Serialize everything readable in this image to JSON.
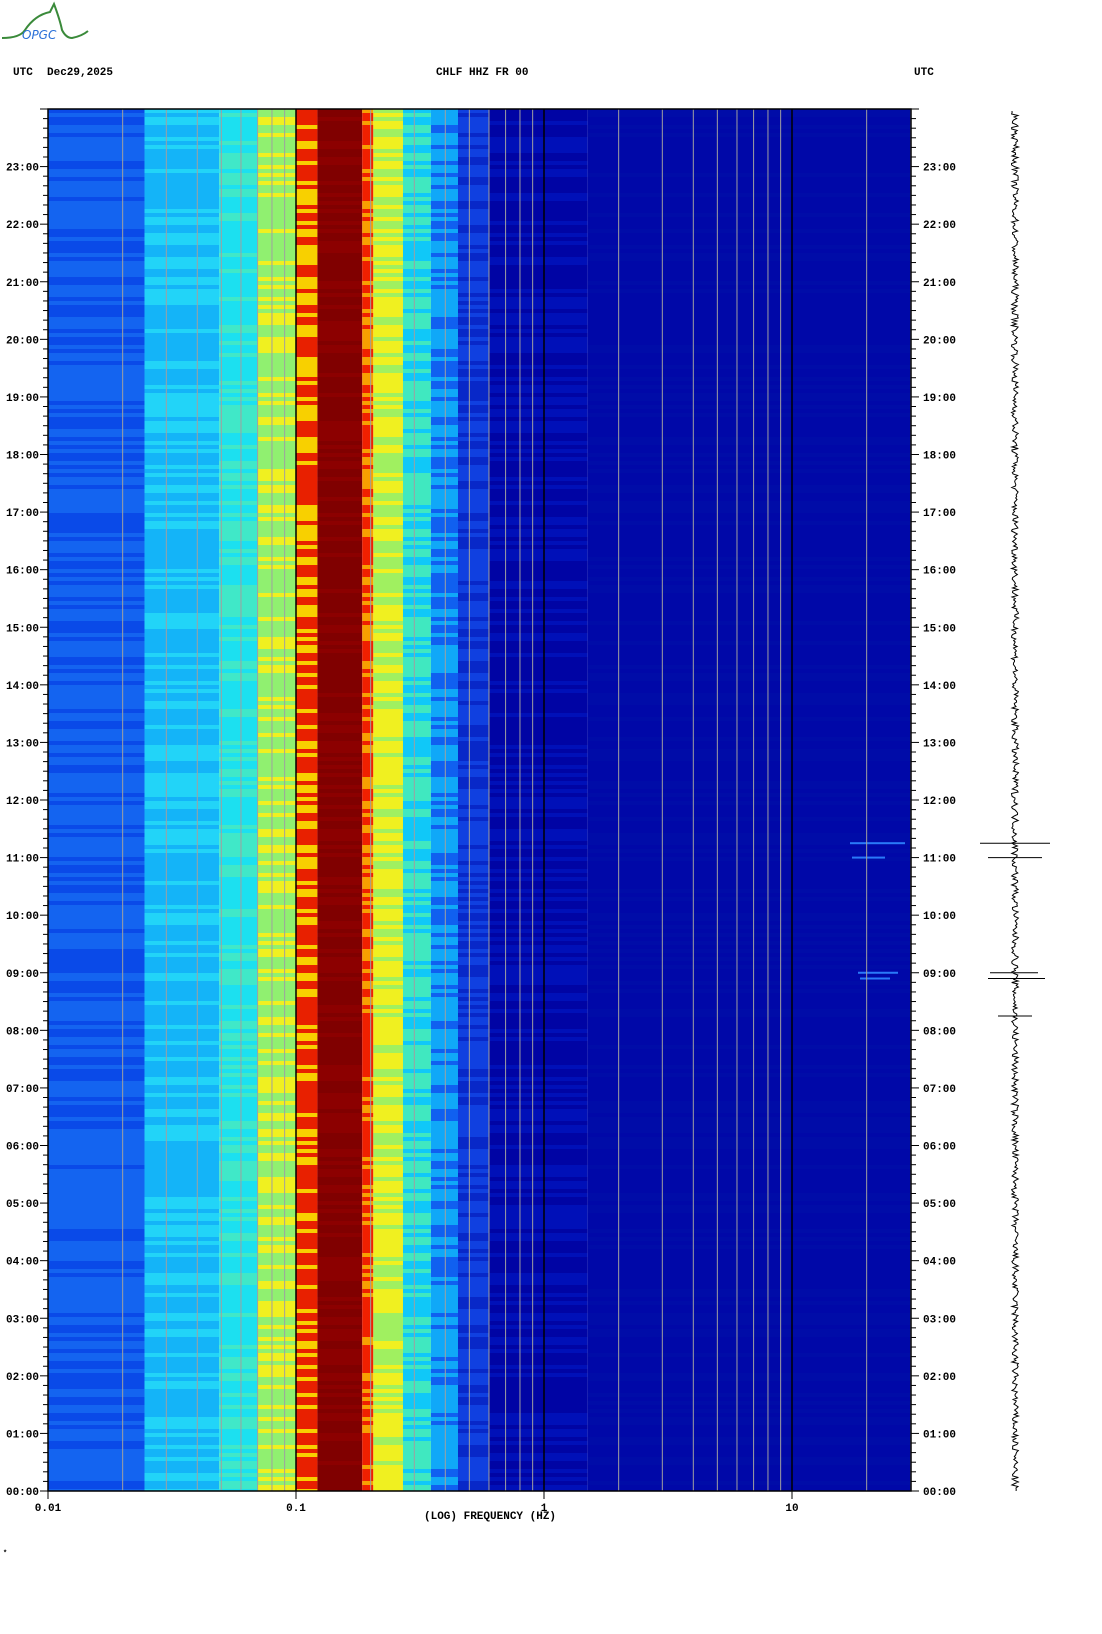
{
  "header": {
    "left_tz": "UTC",
    "date": "Dec29,2025",
    "station": "CHLF HHZ FR 00",
    "right_tz": "UTC"
  },
  "logo_text": "OPGC",
  "footer_mark": "*",
  "chart_data": {
    "type": "heatmap",
    "title": "CHLF HHZ FR 00",
    "subtitle": "Dec29,2025",
    "xlabel": "(LOG) FREQUENCY (HZ)",
    "ylabel": "UTC",
    "xscale": "log",
    "xlim": [
      0.01,
      30
    ],
    "ylim_hours": [
      0,
      24
    ],
    "xticks": [
      {
        "v": 0.01,
        "label": "0.01"
      },
      {
        "v": 0.1,
        "label": "0.1"
      },
      {
        "v": 1,
        "label": "1"
      },
      {
        "v": 10,
        "label": "10"
      }
    ],
    "yticks": [
      "00:00",
      "01:00",
      "02:00",
      "03:00",
      "04:00",
      "05:00",
      "06:00",
      "07:00",
      "08:00",
      "09:00",
      "10:00",
      "11:00",
      "12:00",
      "13:00",
      "14:00",
      "15:00",
      "16:00",
      "17:00",
      "18:00",
      "19:00",
      "20:00",
      "21:00",
      "22:00",
      "23:00"
    ],
    "grid_minor_freqs": [
      0.02,
      0.03,
      0.04,
      0.05,
      0.06,
      0.07,
      0.08,
      0.09,
      0.2,
      0.3,
      0.4,
      0.5,
      0.6,
      0.7,
      0.8,
      0.9,
      2,
      3,
      4,
      5,
      6,
      7,
      8,
      9,
      20
    ],
    "grid_major_freqs": [
      0.1,
      1,
      10
    ],
    "bands": [
      {
        "f": [
          0.01,
          0.0245
        ],
        "level": "low-mid",
        "color": "#1464f0",
        "alt": "#0a4ae8"
      },
      {
        "f": [
          0.0245,
          0.049
        ],
        "level": "mid",
        "color": "#14b4f8",
        "alt": "#22d4f8"
      },
      {
        "f": [
          0.049,
          0.07
        ],
        "level": "mid-high",
        "color": "#1ce0f0",
        "alt": "#40e8c8"
      },
      {
        "f": [
          0.07,
          0.1
        ],
        "level": "high",
        "color": "#90f070",
        "alt": "#f0f020"
      },
      {
        "f": [
          0.1,
          0.122
        ],
        "level": "very-high",
        "color": "#e82000",
        "alt": "#f8d000"
      },
      {
        "f": [
          0.122,
          0.185
        ],
        "level": "max",
        "color": "#800000",
        "alt": "#8c0000"
      },
      {
        "f": [
          0.185,
          0.205
        ],
        "level": "very-high",
        "color": "#f02000",
        "alt": "#f8a000"
      },
      {
        "f": [
          0.205,
          0.27
        ],
        "level": "high",
        "color": "#f0f020",
        "alt": "#a0f060"
      },
      {
        "f": [
          0.27,
          0.35
        ],
        "level": "mid-high",
        "color": "#40e8c0",
        "alt": "#10c8f8"
      },
      {
        "f": [
          0.35,
          0.45
        ],
        "level": "mid",
        "color": "#10a8f8",
        "alt": "#1060f0"
      },
      {
        "f": [
          0.45,
          0.6
        ],
        "level": "low-mid",
        "color": "#1040e0",
        "alt": "#0828c8"
      },
      {
        "f": [
          0.6,
          1.5
        ],
        "level": "low",
        "color": "#0004a4",
        "alt": "#0010b8"
      },
      {
        "f": [
          1.5,
          30
        ],
        "level": "low",
        "color": "#0008a8",
        "alt": "#000ca8"
      }
    ],
    "events_hours": [
      11.25,
      11.0,
      9.0,
      8.9,
      8.25
    ]
  }
}
